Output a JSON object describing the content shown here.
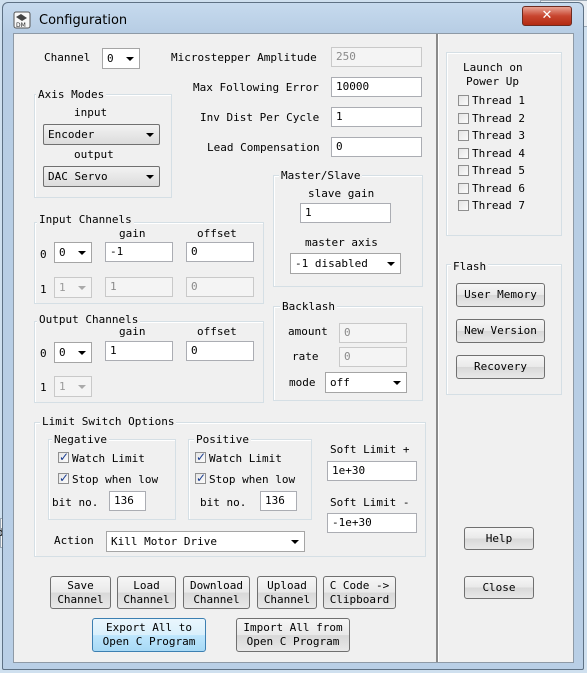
{
  "window": {
    "title": "Configuration",
    "close_glyph": "✕"
  },
  "background_window": {
    "partial_text": "da"
  },
  "channel": {
    "label": "Channel",
    "value": "0"
  },
  "amplitude": {
    "label": "Microstepper Amplitude",
    "value": "250"
  },
  "max_following_error": {
    "label": "Max Following Error",
    "value": "10000"
  },
  "inv_dist_per_cycle": {
    "label": "Inv Dist Per Cycle",
    "value": "1"
  },
  "lead_compensation": {
    "label": "Lead Compensation",
    "value": "0"
  },
  "axis_modes": {
    "title": "Axis Modes",
    "input_label": "input",
    "input_value": "Encoder",
    "output_label": "output",
    "output_value": "DAC Servo"
  },
  "master_slave": {
    "title": "Master/Slave",
    "slave_gain_label": "slave gain",
    "slave_gain_value": "1",
    "master_axis_label": "master axis",
    "master_axis_value": "-1 disabled"
  },
  "input_channels": {
    "title": "Input Channels",
    "gain_label": "gain",
    "offset_label": "offset",
    "rows": [
      {
        "index": "0",
        "channel": "0",
        "gain": "-1",
        "offset": "0"
      },
      {
        "index": "1",
        "channel": "1",
        "gain": "1",
        "offset": "0"
      }
    ]
  },
  "output_channels": {
    "title": "Output Channels",
    "gain_label": "gain",
    "offset_label": "offset",
    "rows": [
      {
        "index": "0",
        "channel": "0",
        "gain": "1",
        "offset": "0"
      },
      {
        "index": "1",
        "channel": "1"
      }
    ]
  },
  "backlash": {
    "title": "Backlash",
    "amount_label": "amount",
    "amount_value": "0",
    "rate_label": "rate",
    "rate_value": "0",
    "mode_label": "mode",
    "mode_value": "off"
  },
  "limit_switch": {
    "title": "Limit Switch Options",
    "negative": {
      "title": "Negative",
      "watch_label": "Watch Limit",
      "watch_checked": true,
      "stop_label": "Stop when low",
      "stop_checked": true,
      "bit_label": "bit no.",
      "bit_value": "136"
    },
    "positive": {
      "title": "Positive",
      "watch_label": "Watch Limit",
      "watch_checked": true,
      "stop_label": "Stop when low",
      "stop_checked": true,
      "bit_label": "bit no.",
      "bit_value": "136"
    },
    "soft_plus_label": "Soft Limit +",
    "soft_plus_value": "1e+30",
    "soft_minus_label": "Soft Limit -",
    "soft_minus_value": "-1e+30",
    "action_label": "Action",
    "action_value": "Kill Motor Drive"
  },
  "buttons": {
    "save_channel": "Save\nChannel",
    "load_channel": "Load\nChannel",
    "download_channel": "Download\nChannel",
    "upload_channel": "Upload\nChannel",
    "c_code_clipboard": "C Code ->\nClipboard",
    "export_all": "Export All to\nOpen C Program",
    "import_all": "Import All from\nOpen C Program"
  },
  "launch": {
    "title_line1": "Launch on",
    "title_line2": "Power Up",
    "threads": [
      "Thread 1",
      "Thread 2",
      "Thread 3",
      "Thread 4",
      "Thread 5",
      "Thread 6",
      "Thread 7"
    ]
  },
  "flash": {
    "title": "Flash",
    "user_memory": "User Memory",
    "new_version": "New Version",
    "recovery": "Recovery"
  },
  "side_buttons": {
    "help": "Help",
    "close": "Close"
  }
}
